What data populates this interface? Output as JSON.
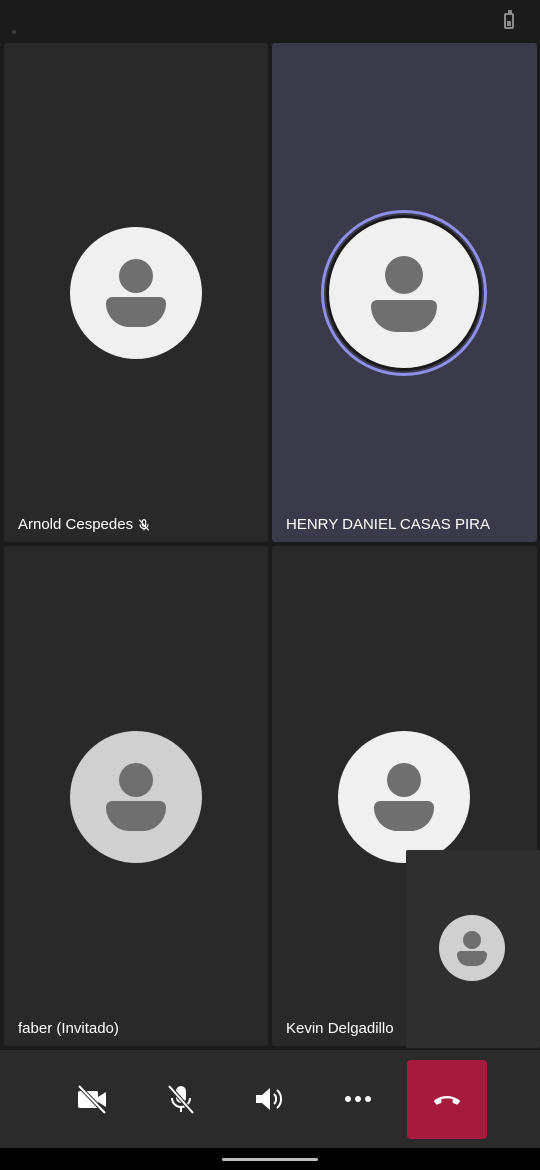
{
  "participants": [
    {
      "name": "Arnold Cespedes",
      "muted": true,
      "active": false
    },
    {
      "name": "HENRY DANIEL CASAS PIRA",
      "muted": false,
      "active": true
    },
    {
      "name": "faber (Invitado)",
      "muted": false,
      "active": false
    },
    {
      "name": "Kevin Delgadillo",
      "muted": false,
      "active": false
    }
  ],
  "toolbar": {
    "camera_icon": "camera-off-icon",
    "mic_icon": "mic-off-icon",
    "speaker_icon": "speaker-icon",
    "more_icon": "more-icon",
    "hangup_icon": "hang-up-icon",
    "hangup_color": "#a51a3d"
  },
  "colors": {
    "active_ring": "#8e8fe6",
    "active_tile": "#3b3a4a",
    "tile": "#292929"
  }
}
